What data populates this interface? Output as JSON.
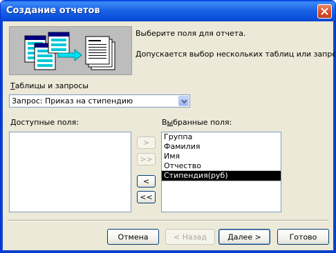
{
  "window": {
    "title": "Создание отчетов"
  },
  "intro": {
    "line1": "Выберите поля для отчета.",
    "line2": "Допускается выбор нескольких таблиц или запросов."
  },
  "source": {
    "label_underlined": "Т",
    "label_rest": "аблицы и запросы",
    "selected": "Запрос: Приказ на стипендию"
  },
  "available": {
    "label_underlined": "Д",
    "label_rest": "оступные поля:",
    "items": []
  },
  "selected_fields": {
    "label_pre": "В",
    "label_underlined": "ы",
    "label_rest": "бранные поля:",
    "items": [
      "Группа",
      "Фамилия",
      "Имя",
      "Отчество",
      "Стипендия(руб)"
    ],
    "highlighted": "Стипендия(руб)"
  },
  "move_buttons": {
    "add_one": ">",
    "add_all": ">>",
    "remove_one": "<",
    "remove_all": "<<"
  },
  "footer": {
    "cancel": "Отмена",
    "back": "< Назад",
    "next": "Далее >",
    "finish": "Готово"
  },
  "colors": {
    "titlebar": "#0b4fdc",
    "dialog_bg": "#ece9d8",
    "accent_cyan": "#00c8d8",
    "selection_bg": "#000000"
  },
  "icons": {
    "close": "close-icon",
    "dropdown": "chevron-down-icon",
    "illustration": "report-wizard-illustration"
  }
}
